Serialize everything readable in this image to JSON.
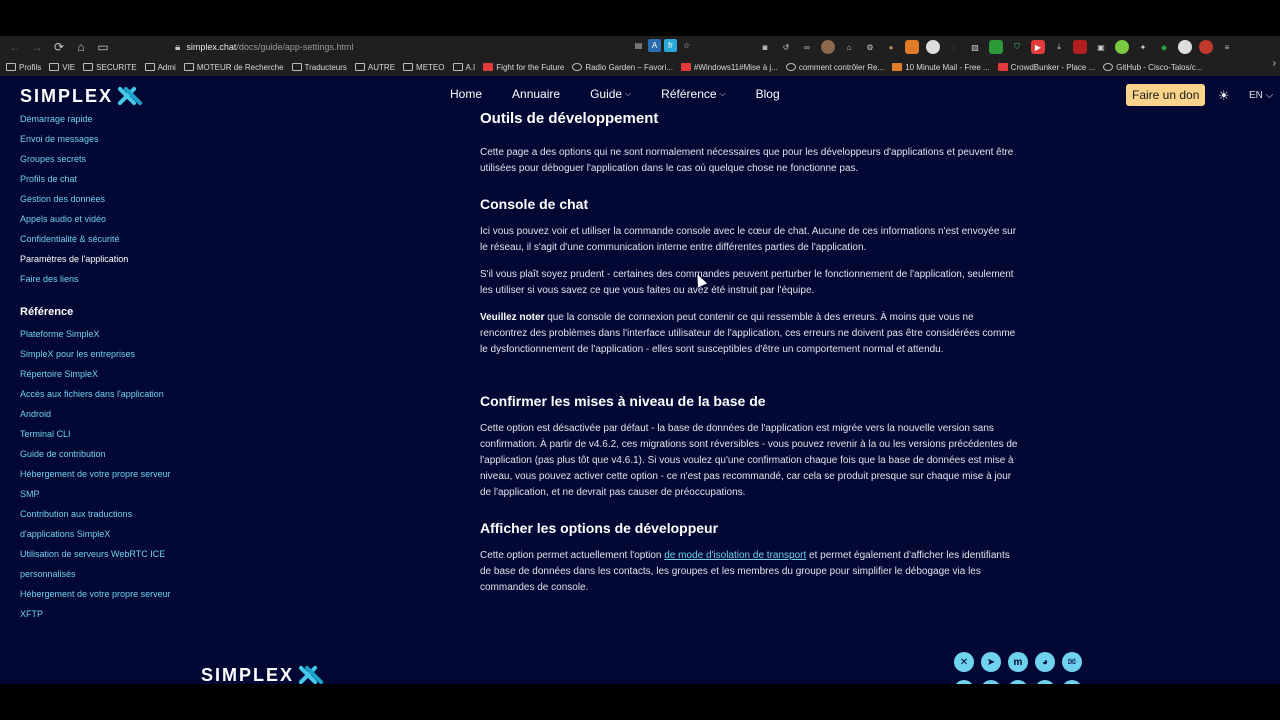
{
  "browser": {
    "url_host": "simplex.chat",
    "url_path": "/docs/guide/app-settings.html",
    "bookmarks": [
      {
        "label": "Profils",
        "icon": "folder"
      },
      {
        "label": "VIE",
        "icon": "folder"
      },
      {
        "label": "SECURITE",
        "icon": "folder"
      },
      {
        "label": "Admi",
        "icon": "folder"
      },
      {
        "label": "MOTEUR de Recherche",
        "icon": "folder"
      },
      {
        "label": "Traducteurs",
        "icon": "folder"
      },
      {
        "label": "AUTRE",
        "icon": "folder"
      },
      {
        "label": "METEO",
        "icon": "folder"
      },
      {
        "label": "A.I",
        "icon": "folder"
      },
      {
        "label": "Fight for the Future",
        "icon": "red"
      },
      {
        "label": "Radio Garden – Favori...",
        "icon": "round"
      },
      {
        "label": "#Windows11#Mise à j...",
        "icon": "red"
      },
      {
        "label": "comment contrôler Re...",
        "icon": "round"
      },
      {
        "label": "10 Minute Mail - Free ...",
        "icon": "orange"
      },
      {
        "label": "CrowdBunker - Place ...",
        "icon": "red"
      },
      {
        "label": "GitHub - Cisco-Talos/c...",
        "icon": "round"
      }
    ]
  },
  "header": {
    "logo": "SIMPLEX",
    "nav": [
      "Home",
      "Annuaire",
      "Guide",
      "Référence",
      "Blog"
    ],
    "donate": "Faire un don",
    "lang": "EN"
  },
  "sidebar": {
    "guide_items": [
      "Démarrage rapide",
      "Envoi de messages",
      "Groupes secrets",
      "Profils de chat",
      "Gestion des données",
      "Appels audio et vidéo",
      "Confidentialité & sécurité",
      "Paramètres de l'application",
      "Faire des liens"
    ],
    "reference_heading": "Référence",
    "reference_items": [
      "Plateforme SimpleX",
      "SimpleX pour les entreprises",
      "Répertoire SimpleX",
      "Accès aux fichiers dans l'application",
      "Android",
      "Terminal CLI",
      "Guide de contribution",
      "Hébergement de votre propre serveur",
      "SMP",
      "Contribution aux traductions",
      "d'applications SimpleX",
      "Utilisation de serveurs WebRTC ICE",
      "personnalisés",
      "Hébergement de votre propre serveur",
      "XFTP"
    ]
  },
  "content": {
    "h_dev": "Outils de développement",
    "p_dev": "Cette page a des options qui ne sont normalement nécessaires que pour les développeurs d'applications et peuvent être utilisées pour déboguer l'application dans le cas où quelque chose ne fonctionne pas.",
    "h_console": "Console de chat",
    "p_console1": "Ici vous pouvez voir et utiliser la commande console avec le cœur de chat. Aucune de ces informations n'est envoyée sur le réseau, il s'agit d'une communication interne entre différentes parties de l'application.",
    "p_console2": "S'il vous plaît soyez prudent - certaines des commandes peuvent perturber le fonctionnement de l'application, seulement les utiliser si vous savez ce que vous faites ou avez été instruit par l'équipe.",
    "p_note_bold": "Veuillez noter",
    "p_note_rest": " que la console de connexion peut contenir ce qui ressemble à des erreurs. À moins que vous ne rencontrez des problèmes dans l'interface utilisateur de l'application, ces erreurs ne doivent pas être considérées comme le dysfonctionnement de l'application - elles sont susceptibles d'être un comportement normal et attendu.",
    "h_db": "Confirmer les mises à niveau de la base de",
    "p_db": "Cette option est désactivée par défaut - la base de données de l'application est migrée vers la nouvelle version sans confirmation. À partir de v4.6.2, ces migrations sont réversibles - vous pouvez revenir à la ou les versions précédentes de l'application (pas plus tôt que v4.6.1). Si vous voulez qu'une confirmation chaque fois que la base de données est mise à niveau, vous pouvez activer cette option - ce n'est pas recommandé, car cela se produit presque sur chaque mise à jour de l'application, et ne devrait pas causer de préoccupations.",
    "h_devopts": "Afficher les options de développeur",
    "p_devopts_a": "Cette option permet actuellement l'option ",
    "p_devopts_link": "de mode d'isolation de transport",
    "p_devopts_b": " et permet également d'afficher les identifiants de base de données dans les contacts, les groupes et les membres du groupe pour simplifier le débogage via les commandes de console."
  },
  "footer": {
    "logo": "SIMPLEX"
  },
  "colors": {
    "page_bg": "#020733",
    "link": "#6fd2ee",
    "donate_bg": "#fad48a"
  }
}
